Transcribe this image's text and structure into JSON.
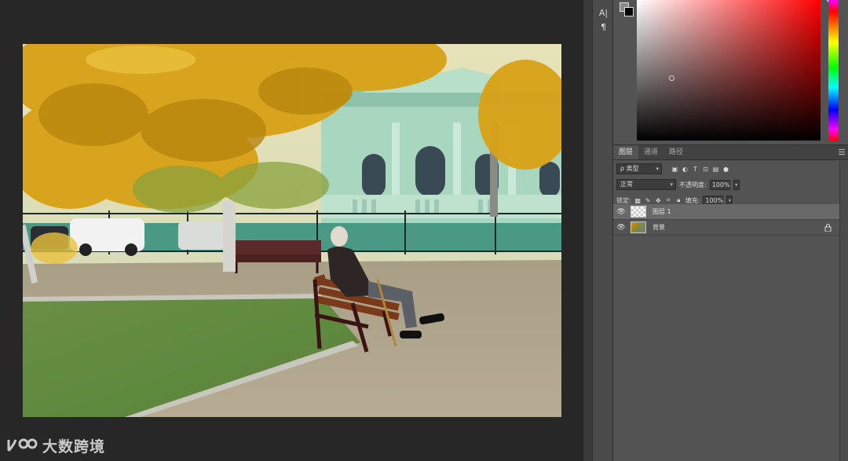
{
  "watermark": {
    "text": "大数跨境"
  },
  "tool_strip": {
    "items": [
      {
        "label": "A|",
        "icon": "character-panel-icon"
      },
      {
        "label": "¶",
        "icon": "paragraph-panel-icon"
      }
    ]
  },
  "color_panel": {
    "foreground_color": "#8a8a8a",
    "background_color": "#000000",
    "hue_color": "#ff0000"
  },
  "layers_panel": {
    "tabs": [
      {
        "label": "图层",
        "active": true
      },
      {
        "label": "通道",
        "active": false
      },
      {
        "label": "路径",
        "active": false
      }
    ],
    "filter_kind": "ρ 类型",
    "blend_mode": "正常",
    "opacity_label": "不透明度:",
    "opacity_value": "100%",
    "lock_label": "锁定:",
    "fill_label": "填充:",
    "fill_value": "100%",
    "layers": [
      {
        "name": "图层 1",
        "visible": true,
        "selected": true,
        "thumbnail": "transparent",
        "locked": false
      },
      {
        "name": "背景",
        "visible": true,
        "selected": false,
        "thumbnail": "photo",
        "locked": true
      }
    ]
  }
}
